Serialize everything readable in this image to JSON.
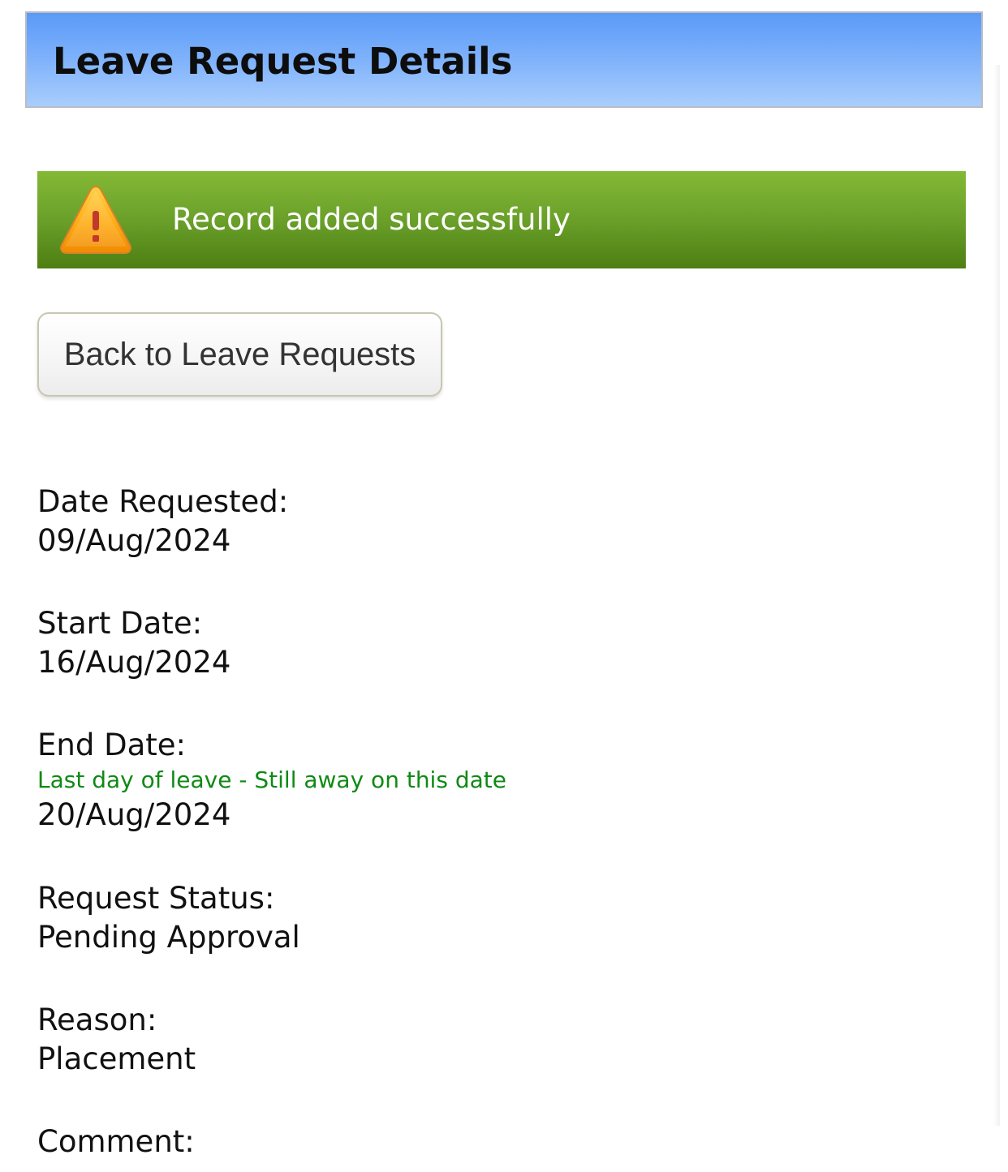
{
  "header": {
    "title": "Leave Request Details"
  },
  "alert": {
    "icon": "warning-icon",
    "message": "Record added successfully"
  },
  "back_button": {
    "label": "Back to Leave Requests"
  },
  "details": {
    "date_requested": {
      "label": "Date Requested:",
      "value": "09/Aug/2024"
    },
    "start_date": {
      "label": "Start Date:",
      "value": "16/Aug/2024"
    },
    "end_date": {
      "label": "End Date:",
      "hint": "Last day of leave - Still away on this date",
      "value": "20/Aug/2024"
    },
    "request_status": {
      "label": "Request Status:",
      "value": "Pending Approval"
    },
    "reason": {
      "label": "Reason:",
      "value": "Placement"
    },
    "comment": {
      "label": "Comment:"
    }
  },
  "colors": {
    "header_gradient": [
      "#5a9af8",
      "#a9cdfd"
    ],
    "alert_gradient": [
      "#84b935",
      "#4d7e12"
    ],
    "hint_text": "#0f8a14"
  }
}
